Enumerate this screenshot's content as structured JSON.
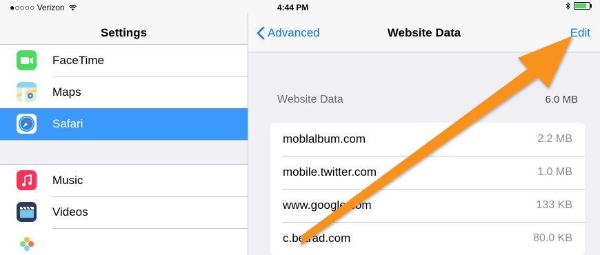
{
  "status_bar": {
    "carrier": "●○○○○ Verizon",
    "wifi_icon": "wifi-icon",
    "time": "4:44 PM",
    "bluetooth_icon": "bluetooth-icon",
    "battery_level": 0.8,
    "battery_color": "#4cd964"
  },
  "master": {
    "title": "Settings",
    "group1": [
      {
        "label": "FaceTime",
        "icon": "facetime-icon",
        "color": "#4cd964"
      },
      {
        "label": "Maps",
        "icon": "maps-icon",
        "color": "#8fd3f4"
      },
      {
        "label": "Safari",
        "icon": "safari-icon",
        "color": "#1e88e5",
        "selected": true
      }
    ],
    "group2": [
      {
        "label": "Music",
        "icon": "music-icon",
        "color": "#fc3158"
      },
      {
        "label": "Videos",
        "icon": "videos-icon",
        "color": "#2b3a55"
      }
    ]
  },
  "detail": {
    "back_label": "Advanced",
    "title": "Website Data",
    "edit_label": "Edit",
    "section_label": "Website Data",
    "section_total": "6.0 MB",
    "sites": [
      {
        "domain": "moblalbum.com",
        "size": "2.2 MB"
      },
      {
        "domain": "mobile.twitter.com",
        "size": "1.0 MB"
      },
      {
        "domain": "www.google.com",
        "size": "133 KB"
      },
      {
        "domain": "c.betrad.com",
        "size": "80.0 KB"
      }
    ]
  },
  "theme": {
    "accent": "#0a7aff",
    "selection": "#3b99fc",
    "annotation_arrow": "#f7931e"
  }
}
